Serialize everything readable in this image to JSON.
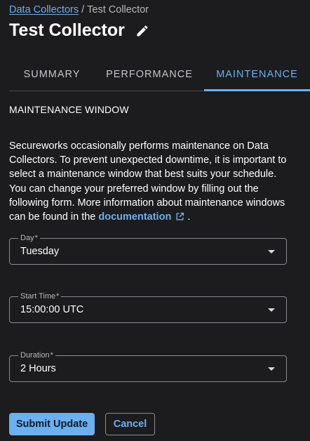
{
  "breadcrumb": {
    "parent": "Data Collectors",
    "separator": "/",
    "current": "Test Collector"
  },
  "page": {
    "title": "Test Collector",
    "edit_icon": "pencil-icon"
  },
  "tabs": [
    {
      "label": "SUMMARY",
      "active": false
    },
    {
      "label": "PERFORMANCE",
      "active": false
    },
    {
      "label": "MAINTENANCE",
      "active": true
    }
  ],
  "section": {
    "heading": "MAINTENANCE WINDOW",
    "description": "Secureworks occasionally performs maintenance on Data Collectors. To prevent unexpected downtime, it is important to select a maintenance window that best suits your schedule. You can change your preferred window by filling out the following form. More information about maintenance windows can be found in the ",
    "link_text": "documentation",
    "link_icon": "external-link-icon",
    "description_end": "."
  },
  "form": {
    "day": {
      "label": "Day",
      "required_mark": "*",
      "value": "Tuesday"
    },
    "start_time": {
      "label": "Start Time",
      "required_mark": "*",
      "value": "15:00:00 UTC"
    },
    "duration": {
      "label": "Duration",
      "required_mark": "*",
      "value": "2 Hours"
    }
  },
  "actions": {
    "submit_label": "Submit Update",
    "cancel_label": "Cancel"
  },
  "colors": {
    "background": "#1c1c1e",
    "accent": "#6cb0f0",
    "text": "#ffffff",
    "muted": "#b8b8bd",
    "border": "#8a8a90"
  }
}
